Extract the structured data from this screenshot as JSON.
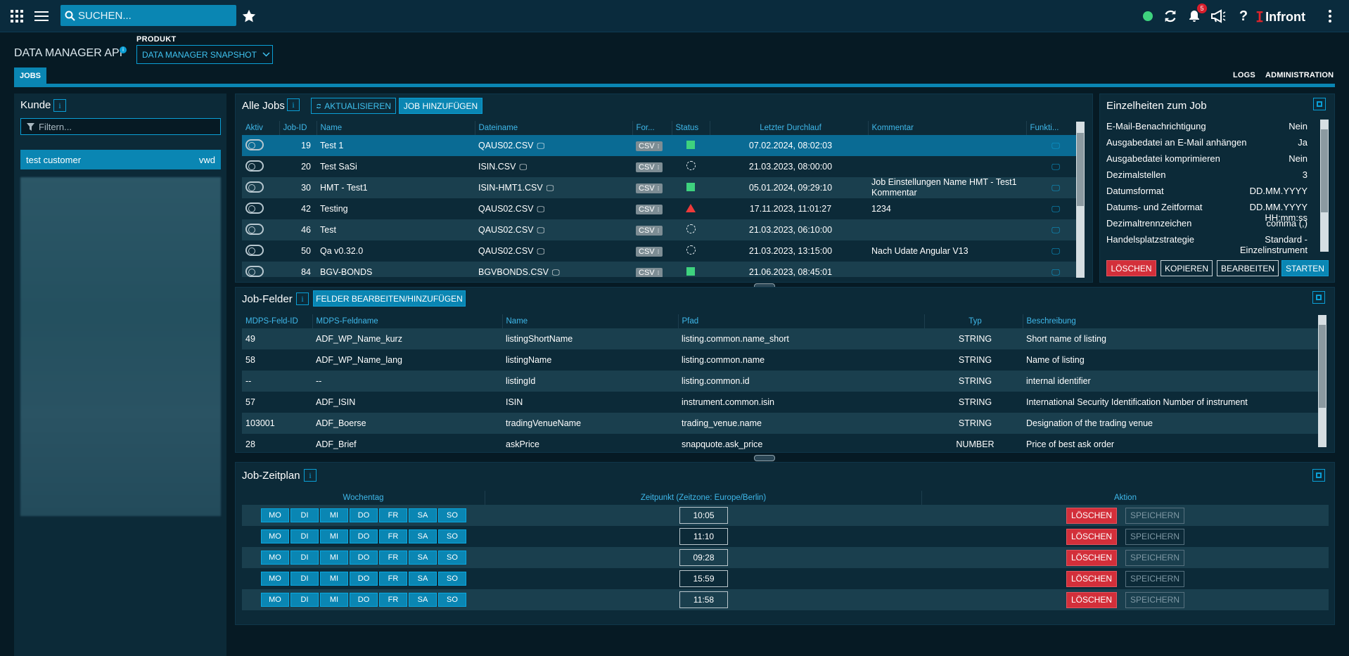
{
  "topbar": {
    "search_placeholder": "SUCHEN...",
    "notifications_count": "5",
    "logo_text": "Infront",
    "status_color": "#3ed27e"
  },
  "header": {
    "app_title": "DATA MANAGER API",
    "product_label": "PRODUKT",
    "product_value": "DATA MANAGER SNAPSHOT",
    "tab_jobs": "JOBS",
    "link_logs": "LOGS",
    "link_admin": "ADMINISTRATION"
  },
  "kunde": {
    "title": "Kunde",
    "filter_placeholder": "Filtern...",
    "customer_name": "test customer",
    "customer_code": "vwd"
  },
  "alle_jobs": {
    "title": "Alle Jobs",
    "btn_refresh": "AKTUALISIEREN",
    "btn_add": "JOB HINZUFÜGEN",
    "columns": [
      "Aktiv",
      "Job-ID",
      "Name",
      "Dateiname",
      "For...",
      "Status",
      "Letzter Durchlauf",
      "Kommentar",
      "Funkti..."
    ],
    "rows": [
      {
        "id": "19",
        "name": "Test 1",
        "file": "QAUS02.CSV",
        "format": "CSV",
        "status": "ok",
        "last": "07.02.2024, 08:02:03",
        "comment": "",
        "comment2": ""
      },
      {
        "id": "20",
        "name": "Test SaSi",
        "file": "ISIN.CSV",
        "format": "CSV",
        "status": "pending",
        "last": "21.03.2023, 08:00:00",
        "comment": "",
        "comment2": ""
      },
      {
        "id": "30",
        "name": "HMT - Test1",
        "file": "ISIN-HMT1.CSV",
        "format": "CSV",
        "status": "ok",
        "last": "05.01.2024, 09:29:10",
        "comment": "Job Einstellungen Name HMT - Test1",
        "comment2": "Kommentar"
      },
      {
        "id": "42",
        "name": "Testing",
        "file": "QAUS02.CSV",
        "format": "CSV",
        "status": "error",
        "last": "17.11.2023, 11:01:27",
        "comment": "1234",
        "comment2": ""
      },
      {
        "id": "46",
        "name": "Test",
        "file": "QAUS02.CSV",
        "format": "CSV",
        "status": "pending",
        "last": "21.03.2023, 06:10:00",
        "comment": "",
        "comment2": ""
      },
      {
        "id": "50",
        "name": "Qa v0.32.0",
        "file": "QAUS02.CSV",
        "format": "CSV",
        "status": "pending",
        "last": "21.03.2023, 13:15:00",
        "comment": "Nach Udate Angular V13",
        "comment2": ""
      },
      {
        "id": "84",
        "name": "BGV-BONDS",
        "file": "BGVBONDS.CSV",
        "format": "CSV",
        "status": "ok",
        "last": "21.06.2023, 08:45:01",
        "comment": "",
        "comment2": ""
      }
    ]
  },
  "details": {
    "title": "Einzelheiten zum Job",
    "items": [
      {
        "label": "E-Mail-Benachrichtigung",
        "value": "Nein"
      },
      {
        "label": "Ausgabedatei an E-Mail anhängen",
        "value": "Ja"
      },
      {
        "label": "Ausgabedatei komprimieren",
        "value": "Nein"
      },
      {
        "label": "Dezimalstellen",
        "value": "3"
      },
      {
        "label": "Datumsformat",
        "value": "DD.MM.YYYY"
      },
      {
        "label": "Datums- und Zeitformat",
        "value": "DD.MM.YYYY HH:mm:ss"
      },
      {
        "label": "Dezimaltrennzeichen",
        "value": "comma (,)"
      },
      {
        "label": "Handelsplatzstrategie",
        "value": "Standard - Einzelinstrument"
      }
    ],
    "btn_delete": "LÖSCHEN",
    "btn_copy": "KOPIEREN",
    "btn_edit": "BEARBEITEN",
    "btn_start": "STARTEN"
  },
  "fields": {
    "title": "Job-Felder",
    "btn_edit": "FELDER BEARBEITEN/HINZUFÜGEN",
    "columns": [
      "MDPS-Feld-ID",
      "MDPS-Feldname",
      "Name",
      "Pfad",
      "Typ",
      "Beschreibung"
    ],
    "rows": [
      {
        "fid": "49",
        "fname": "ADF_WP_Name_kurz",
        "name": "listingShortName",
        "path": "listing.common.name_short",
        "type": "STRING",
        "desc": "Short name of listing"
      },
      {
        "fid": "58",
        "fname": "ADF_WP_Name_lang",
        "name": "listingName",
        "path": "listing.common.name",
        "type": "STRING",
        "desc": "Name of listing"
      },
      {
        "fid": "--",
        "fname": "--",
        "name": "listingId",
        "path": "listing.common.id",
        "type": "STRING",
        "desc": "internal identifier"
      },
      {
        "fid": "57",
        "fname": "ADF_ISIN",
        "name": "ISIN",
        "path": "instrument.common.isin",
        "type": "STRING",
        "desc": "International Security Identification Number of instrument"
      },
      {
        "fid": "103001",
        "fname": "ADF_Boerse",
        "name": "tradingVenueName",
        "path": "trading_venue.name",
        "type": "STRING",
        "desc": "Designation of the trading venue"
      },
      {
        "fid": "28",
        "fname": "ADF_Brief",
        "name": "askPrice",
        "path": "snapquote.ask_price",
        "type": "NUMBER",
        "desc": "Price of best ask order"
      }
    ]
  },
  "schedule": {
    "title": "Job-Zeitplan",
    "col_weekday": "Wochentag",
    "col_time": "Zeitpunkt (Zeitzone: Europe/Berlin)",
    "col_action": "Aktion",
    "days": [
      "MO",
      "DI",
      "MI",
      "DO",
      "FR",
      "SA",
      "SO"
    ],
    "btn_delete": "LÖSCHEN",
    "btn_save": "SPEICHERN",
    "times": [
      "10:05",
      "11:10",
      "09:28",
      "15:59",
      "11:58"
    ]
  }
}
